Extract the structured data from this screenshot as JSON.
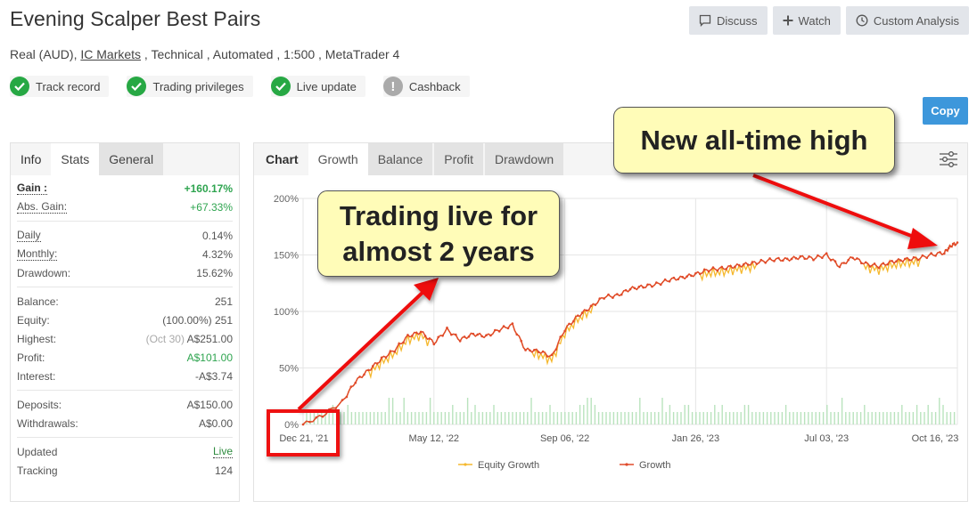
{
  "header": {
    "title": "Evening Scalper Best Pairs",
    "subtitle_prefix": "Real (AUD), ",
    "broker_link": "IC Markets",
    "subtitle_suffix": " , Technical , Automated , 1:500 , MetaTrader 4"
  },
  "badges": [
    {
      "label": "Track record",
      "status": "ok"
    },
    {
      "label": "Trading privileges",
      "status": "ok"
    },
    {
      "label": "Live update",
      "status": "ok"
    },
    {
      "label": "Cashback",
      "status": "warn"
    }
  ],
  "actions": {
    "discuss": "Discuss",
    "watch": "Watch",
    "custom_analysis": "Custom Analysis",
    "copy": "Copy"
  },
  "left_panel": {
    "tabs": [
      "Info",
      "Stats",
      "General"
    ],
    "gain_label": "Gain :",
    "gain_value": "+160.17%",
    "abs_gain_label": "Abs. Gain:",
    "abs_gain_value": "+67.33%",
    "daily_label": "Daily",
    "daily_value": "0.14%",
    "monthly_label": "Monthly:",
    "monthly_value": "4.32%",
    "drawdown_label": "Drawdown:",
    "drawdown_value": "15.62%",
    "balance_label": "Balance:",
    "balance_value": "251",
    "equity_label": "Equity:",
    "equity_pct": "(100.00%)",
    "equity_value": "251",
    "highest_label": "Highest:",
    "highest_date": "(Oct 30)",
    "highest_value": "A$251.00",
    "profit_label": "Profit:",
    "profit_value": "A$101.00",
    "interest_label": "Interest:",
    "interest_value": "-A$3.74",
    "deposits_label": "Deposits:",
    "deposits_value": "A$150.00",
    "withdrawals_label": "Withdrawals:",
    "withdrawals_value": "A$0.00",
    "updated_label": "Updated",
    "updated_value": "Live",
    "tracking_label": "Tracking",
    "tracking_value": "124"
  },
  "chart_panel": {
    "tabs": [
      "Chart",
      "Growth",
      "Balance",
      "Profit",
      "Drawdown"
    ],
    "active_tab": "Growth"
  },
  "chart_data": {
    "type": "line",
    "title": "",
    "xlabel": "",
    "ylabel": "",
    "ylim": [
      0,
      200
    ],
    "y_ticks": [
      "0%",
      "50%",
      "100%",
      "150%",
      "200%"
    ],
    "x_ticks": [
      "Dec 21, '21",
      "May 12, '22",
      "Sep 06, '22",
      "Jan 26, '23",
      "Jul 03, '23",
      "Oct 16, '23"
    ],
    "legend": [
      "Equity Growth",
      "Growth"
    ],
    "legend_position": "bottom",
    "grid": true,
    "colors": {
      "growth": "#e04a2a",
      "equity": "#f5b82e",
      "bars": "#b9e3bd"
    },
    "x_frac": [
      0,
      0.03,
      0.06,
      0.08,
      0.1,
      0.12,
      0.14,
      0.16,
      0.18,
      0.2,
      0.22,
      0.24,
      0.26,
      0.28,
      0.3,
      0.32,
      0.34,
      0.36,
      0.38,
      0.4,
      0.42,
      0.44,
      0.46,
      0.48,
      0.5,
      0.52,
      0.54,
      0.56,
      0.58,
      0.6,
      0.62,
      0.64,
      0.66,
      0.68,
      0.7,
      0.72,
      0.74,
      0.76,
      0.78,
      0.8,
      0.82,
      0.84,
      0.86,
      0.88,
      0.9,
      0.92,
      0.94,
      0.96,
      0.98,
      0.99,
      1.0
    ],
    "growth": [
      0,
      8,
      20,
      38,
      48,
      58,
      66,
      78,
      82,
      72,
      84,
      75,
      80,
      78,
      84,
      88,
      66,
      65,
      60,
      84,
      96,
      104,
      113,
      114,
      120,
      122,
      124,
      128,
      130,
      133,
      137,
      138,
      140,
      142,
      144,
      146,
      146,
      148,
      147,
      150,
      140,
      148,
      142,
      140,
      144,
      146,
      147,
      150,
      152,
      158,
      161
    ]
  },
  "annotations": {
    "callout_left": "Trading live for almost 2 years",
    "callout_left_line1": "Trading live for",
    "callout_left_line2": "almost 2 years",
    "callout_right": "New all-time high"
  }
}
